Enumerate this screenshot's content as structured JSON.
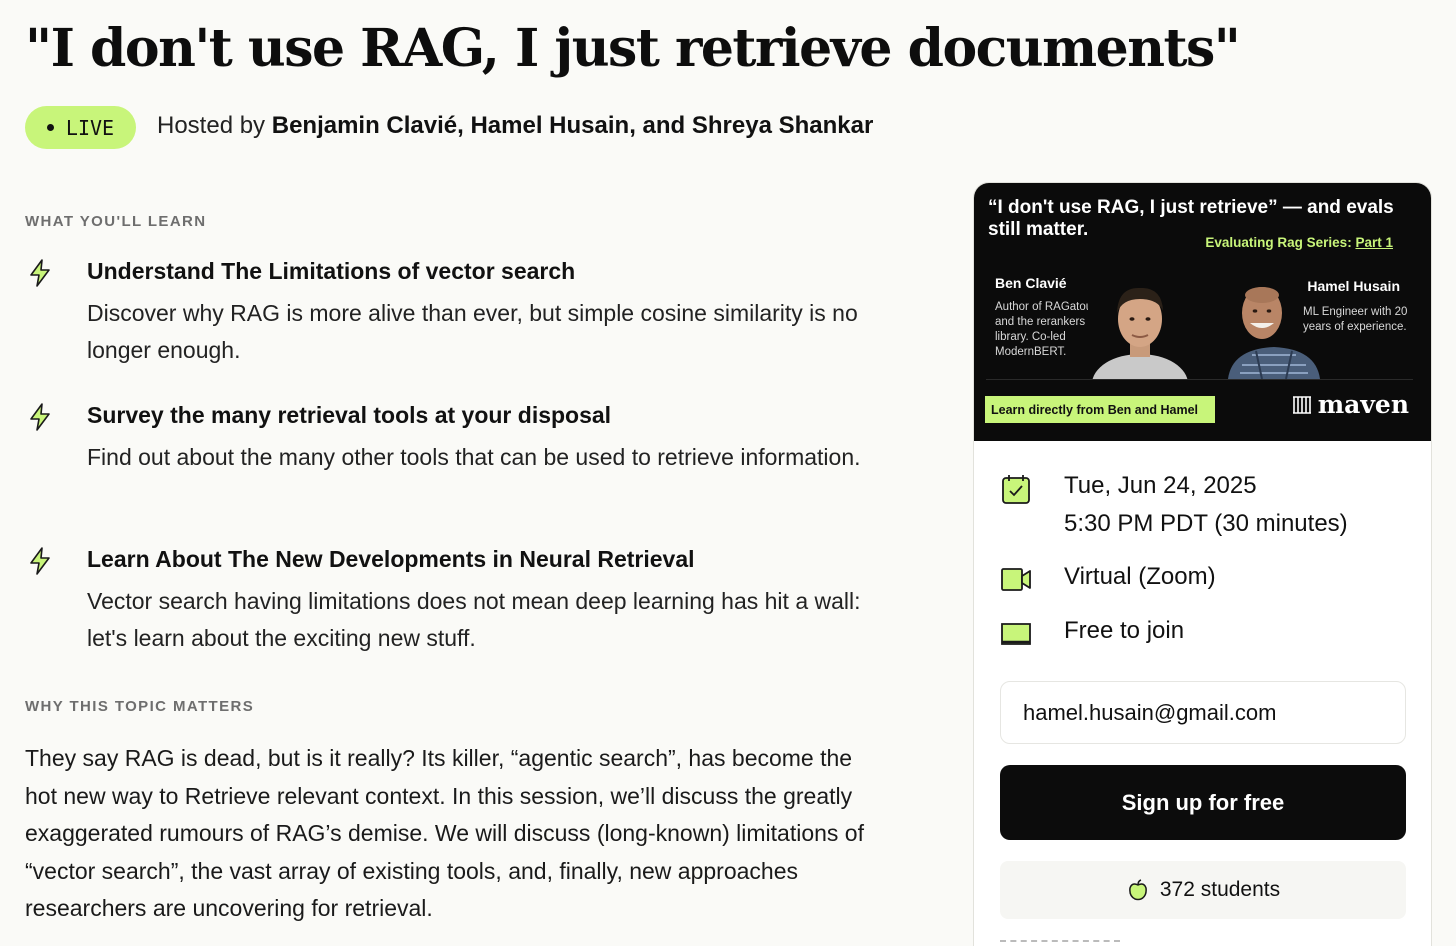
{
  "header": {
    "title": "\"I don't use RAG, I just retrieve documents\"",
    "live_label": "LIVE",
    "hosted_prefix": "Hosted by",
    "hosts": "Benjamin Clavié, Hamel Husain, and Shreya Shankar"
  },
  "learn": {
    "section_label": "WHAT YOU'LL LEARN",
    "items": [
      {
        "title": "Understand The Limitations of vector search",
        "description": "Discover why RAG is more alive than ever, but simple cosine similarity is no longer enough."
      },
      {
        "title": "Survey the many retrieval tools at your disposal",
        "description": "Find out about the many other tools that can be used to retrieve information."
      },
      {
        "title": "Learn About The New Developments in Neural Retrieval",
        "description": "Vector search having limitations does not mean deep learning has hit a wall: let's learn about the exciting new stuff."
      }
    ]
  },
  "why": {
    "section_label": "WHY THIS TOPIC MATTERS",
    "text": "They say RAG is dead, but is it really? Its killer, “agentic search”, has become the hot new way to Retrieve relevant context. In this session, we’ll discuss the greatly exaggerated rumours of RAG’s demise. We will discuss (long-known) limitations of “vector search”, the vast array of existing tools, and, finally, new approaches researchers are uncovering for retrieval."
  },
  "card": {
    "banner": {
      "title": "“I don't use RAG, I just retrieve” — and evals still matter.",
      "series_prefix": "Evaluating Rag Series:",
      "series_part": "Part 1",
      "speaker1_name": "Ben Clavié",
      "speaker1_bio": "Author of RAGatouille and the rerankers library. Co-led ModernBERT.",
      "speaker2_name": "Hamel Husain",
      "speaker2_bio": "ML Engineer with 20 years of experience.",
      "cta": "Learn directly from Ben and Hamel",
      "brand": "maven"
    },
    "date": "Tue, Jun 24, 2025",
    "time": "5:30 PM PDT (30 minutes)",
    "location": "Virtual (Zoom)",
    "price": "Free to join",
    "email_value": "hamel.husain@gmail.com",
    "signup_label": "Sign up for free",
    "students": "372 students"
  },
  "colors": {
    "accent": "#c8f57a",
    "background": "#fafaf7",
    "button": "#0c0c0c"
  },
  "icons": [
    "bolt-icon",
    "calendar-check-icon",
    "video-camera-icon",
    "ticket-icon",
    "apple-icon",
    "maven-logo-icon"
  ]
}
